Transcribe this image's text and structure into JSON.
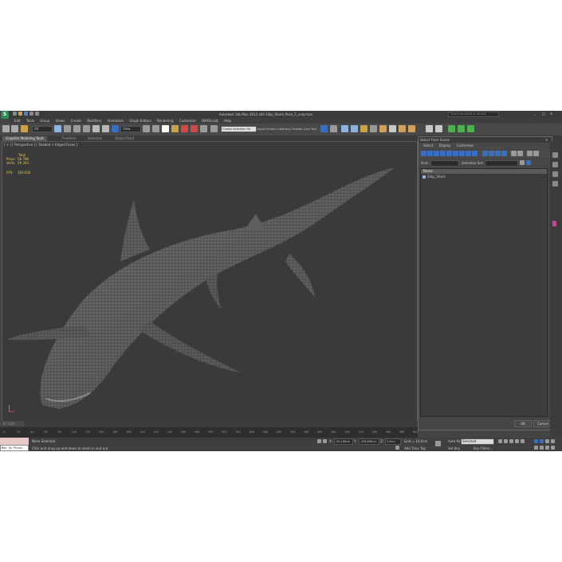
{
  "window": {
    "title": "Autodesk 3ds Max 2012 x64     Silky_Shark_Pose_2_vray.max",
    "search_placeholder": "Type a keyword or phrase"
  },
  "menu": [
    "Edit",
    "Tools",
    "Group",
    "Views",
    "Create",
    "Modifiers",
    "Animation",
    "Graph Editors",
    "Rendering",
    "Customize",
    "MAXScript",
    "Help"
  ],
  "toolbar": {
    "filter_all": "All",
    "view_dropdown": "View",
    "selection_set": "Create Selection Se",
    "liquid_label": "Liquid Studio v delivery Check",
    "cam_tool": "iro Cam Tool"
  },
  "ribbon": {
    "tabs": [
      "Graphite Modeling Tools",
      "Freeform",
      "Selection",
      "Object Paint"
    ]
  },
  "viewport": {
    "label": "[ + ] [ Perspective ] [ Shaded + Edged Faces ]",
    "stats_header": "Total",
    "polys_label": "Polys:",
    "polys_value": "58 796",
    "verts_label": "Verts:",
    "verts_value": "29 393",
    "fps_label": "FPS:",
    "fps_value": "160.026"
  },
  "scene_dialog": {
    "title": "Select From Scene",
    "menu": [
      "Select",
      "Display",
      "Customize"
    ],
    "find_label": "Find:",
    "selection_set_label": "Selection Set:",
    "column_name": "Name",
    "items": [
      "Silky_Shark"
    ],
    "ok_label": "OK",
    "cancel_label": "Cancel"
  },
  "timeline": {
    "frame_display": "0 / 120",
    "ticks": [
      "0",
      "10",
      "20",
      "30",
      "40",
      "50",
      "60",
      "70",
      "80",
      "90",
      "100",
      "110",
      "120",
      "130",
      "140",
      "150",
      "160",
      "170",
      "180",
      "190",
      "200",
      "210",
      "220",
      "230",
      "240",
      "250",
      "260",
      "270",
      "280",
      "290",
      "300",
      "310",
      "320",
      "330",
      "340",
      "350",
      "360",
      "370",
      "380",
      "390",
      "400",
      "410",
      "420",
      "430",
      "440",
      "450",
      "460",
      "470",
      "480",
      "490",
      "500",
      "510",
      "520",
      "530",
      "540",
      "550",
      "560",
      "570",
      "580",
      "590",
      "600"
    ]
  },
  "status": {
    "maxscript": "Max to Physc",
    "selection": "None Selected",
    "prompt": "Click and drag up-and-down to zoom in and out",
    "x_label": "X:",
    "x_value": "-90,188cm",
    "y_label": "Y:",
    "y_value": "-496,608cm",
    "z_label": "Z:",
    "z_value": "0,0cm",
    "grid": "Grid = 10,0cm",
    "add_time_tag": "Add Time Tag",
    "auto_key": "Auto Key",
    "auto_key_value": "Selected",
    "set_key": "Set Key",
    "key_filters": "Key Filters..."
  },
  "colors": {
    "accent_blue": "#3a6fbf",
    "app_bg": "#444444",
    "viewport_bg": "#3a3a3a",
    "stats_yellow": "#e8c84a",
    "logo_green": "#2e8b57"
  }
}
